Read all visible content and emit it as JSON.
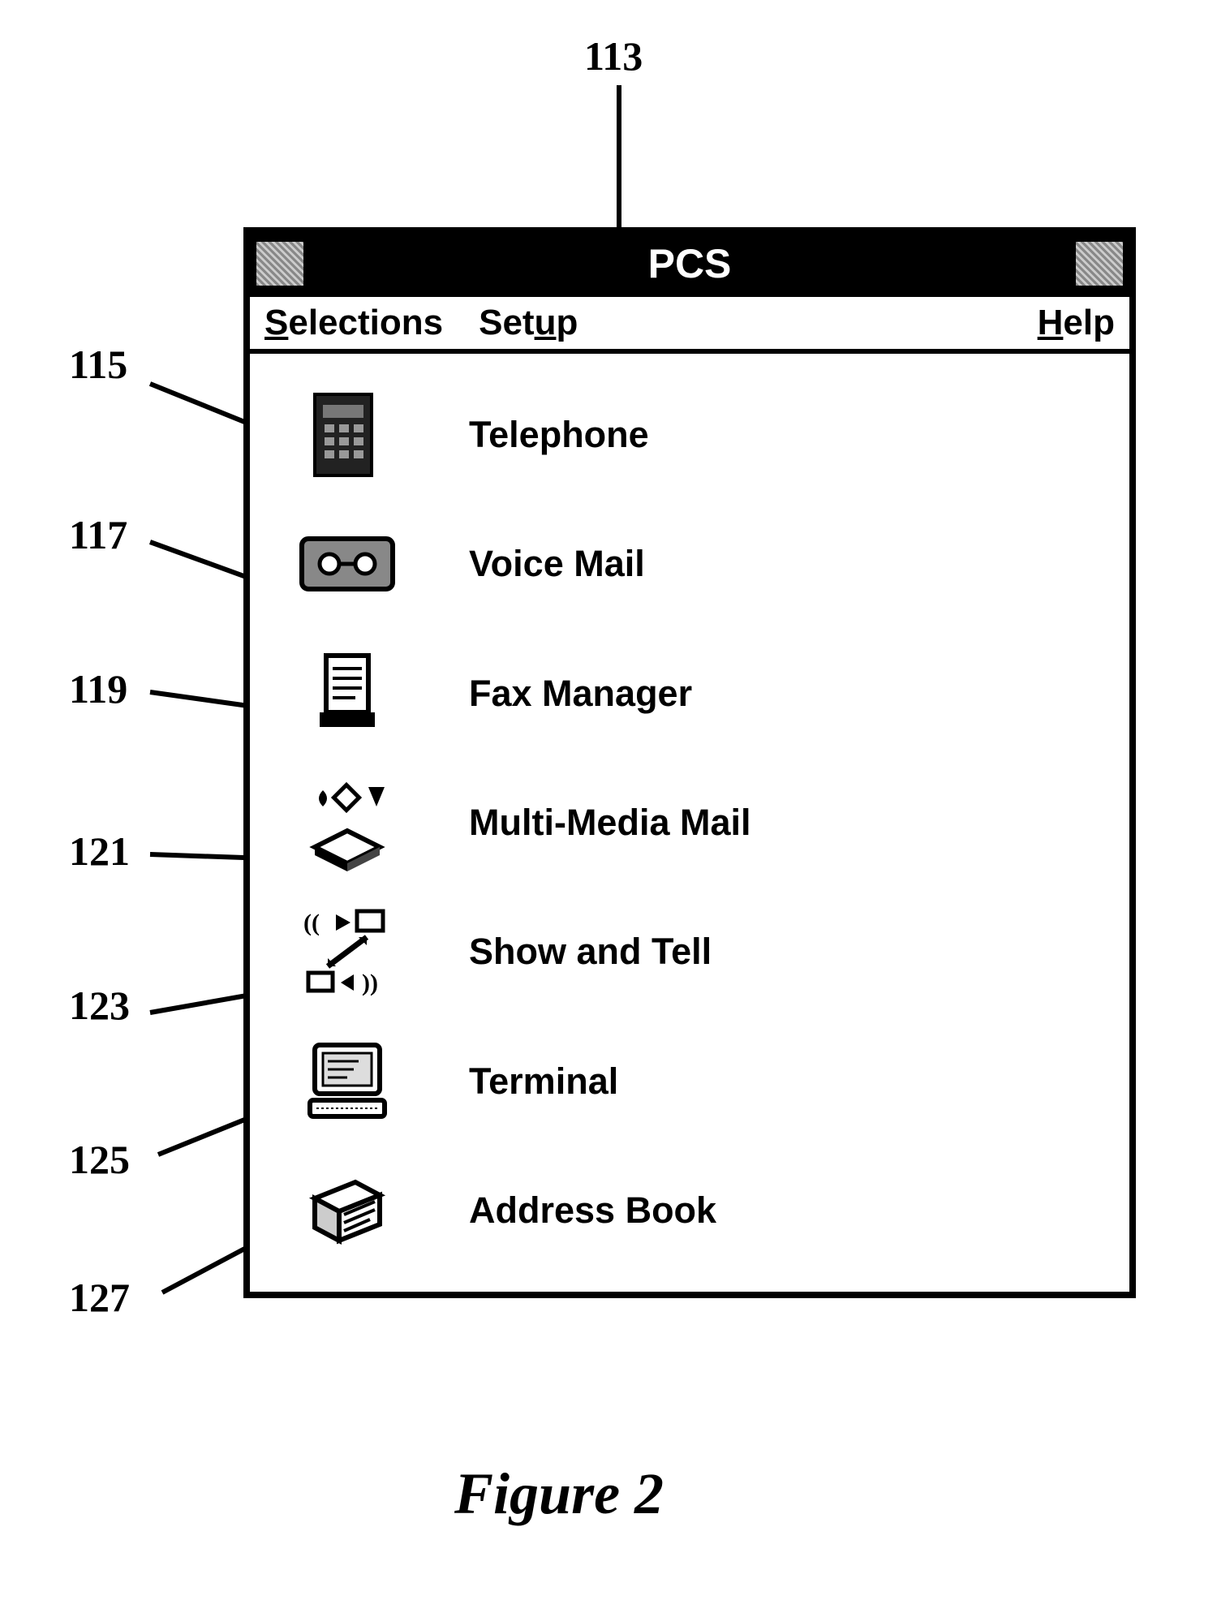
{
  "callouts": {
    "c113": "113",
    "c115": "115",
    "c117": "117",
    "c119": "119",
    "c121": "121",
    "c123": "123",
    "c125": "125",
    "c127": "127"
  },
  "window": {
    "title": "PCS",
    "menu": {
      "selections": "Selections",
      "setup": "Setup",
      "help": "Help"
    },
    "items": [
      {
        "label": "Telephone",
        "icon": "telephone-icon"
      },
      {
        "label": "Voice Mail",
        "icon": "cassette-icon"
      },
      {
        "label": "Fax Manager",
        "icon": "fax-icon"
      },
      {
        "label": "Multi-Media Mail",
        "icon": "multimedia-icon"
      },
      {
        "label": "Show and Tell",
        "icon": "showtell-icon"
      },
      {
        "label": "Terminal",
        "icon": "terminal-icon"
      },
      {
        "label": "Address Book",
        "icon": "addressbook-icon"
      }
    ]
  },
  "caption": "Figure 2"
}
